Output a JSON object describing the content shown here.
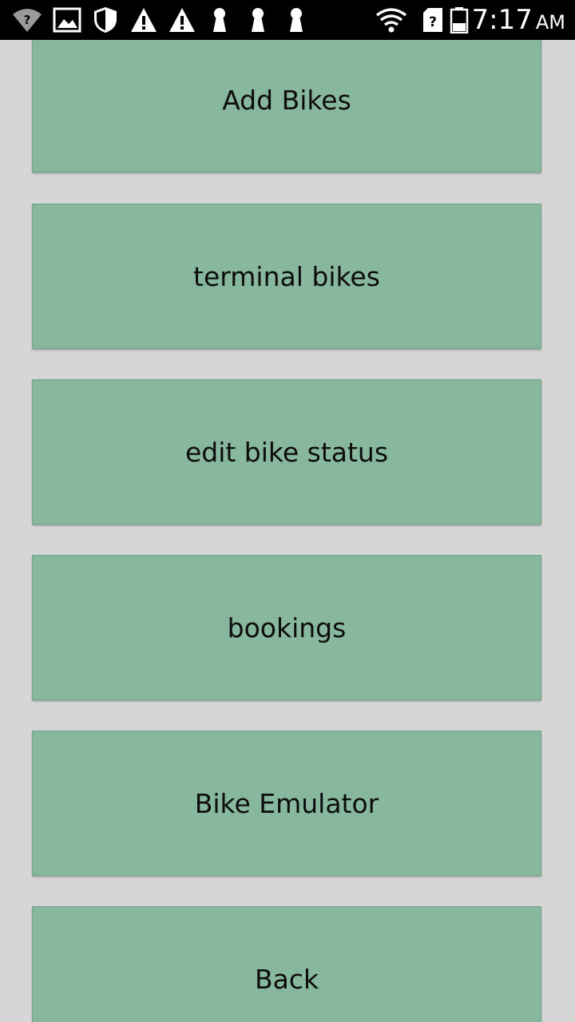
{
  "status_bar": {
    "time": "7:17",
    "ampm": "AM",
    "icons": [
      "wifi-question-icon",
      "image-icon",
      "shield-icon",
      "warning-icon",
      "warning-icon",
      "keyhole-icon",
      "keyhole-icon",
      "keyhole-icon",
      "wifi-signal-icon",
      "sim-unknown-icon",
      "battery-icon"
    ]
  },
  "menu": {
    "items": [
      {
        "label": "Add Bikes"
      },
      {
        "label": "terminal bikes"
      },
      {
        "label": "edit bike status"
      },
      {
        "label": "bookings"
      },
      {
        "label": "Bike Emulator"
      },
      {
        "label": "Back"
      }
    ]
  },
  "colors": {
    "background": "#d6d6d6",
    "button": "#87b89e",
    "status_bar": "#000000"
  }
}
